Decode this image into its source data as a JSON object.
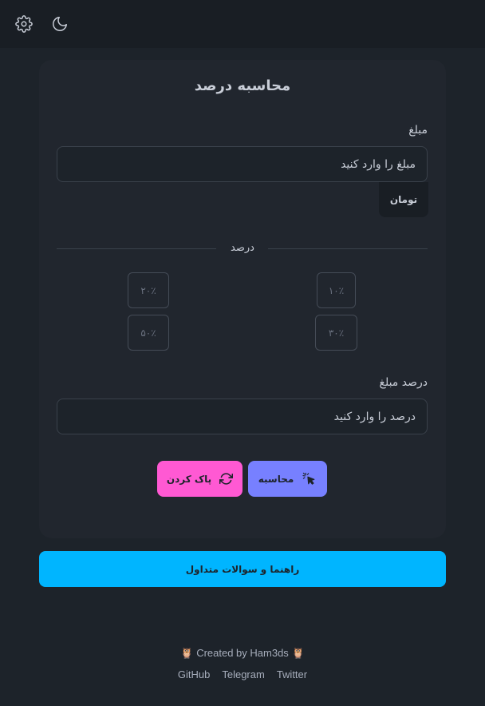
{
  "navbar": {
    "settings_icon": "gear-icon",
    "theme_icon": "moon-icon"
  },
  "card": {
    "title": "محاسبه درصد",
    "amount_label": "مبلغ",
    "amount_placeholder": "مبلغ را وارد کنید",
    "currency": "تومان",
    "percent_divider": "درصد",
    "percent_options": [
      "۲۰٪",
      "۱۰٪",
      "۵۰٪",
      "۳۰٪"
    ],
    "percent_amount_label": "درصد مبلغ",
    "percent_placeholder": "درصد را وارد کنید",
    "calculate_label": "محاسبه",
    "clear_label": "پاک کردن"
  },
  "help_button": "راهنما و سوالات متداول",
  "footer": {
    "credit": "Created by Ham3ds",
    "links": [
      "GitHub",
      "Telegram",
      "Twitter"
    ]
  },
  "colors": {
    "background": "#1d232a",
    "card": "#21262e",
    "calculate": "#7780ff",
    "clear": "#ff59d3",
    "help": "#00b5ff"
  }
}
